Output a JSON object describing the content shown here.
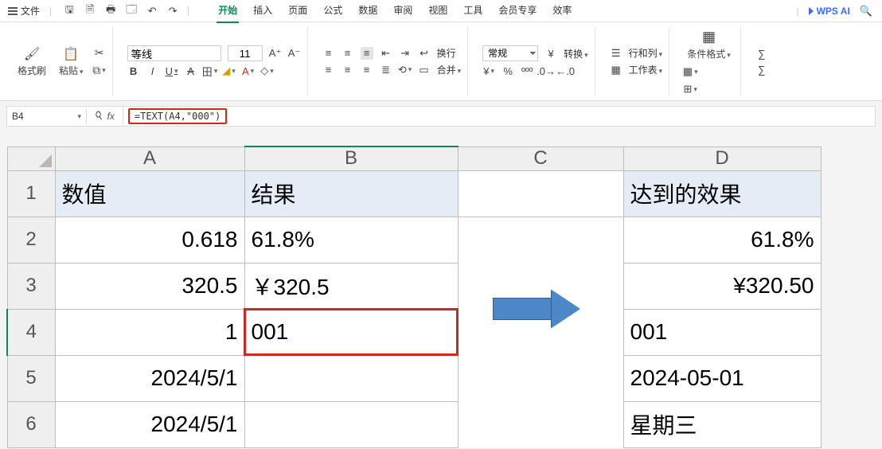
{
  "menu": {
    "file": "文件",
    "tabs": [
      "开始",
      "插入",
      "页面",
      "公式",
      "数据",
      "审阅",
      "视图",
      "工具",
      "会员专享",
      "效率"
    ],
    "active_tab": 0,
    "ai": "WPS AI"
  },
  "ribbon": {
    "format_brush": "格式刷",
    "paste": "粘贴",
    "font_name": "等线",
    "font_size": "11",
    "wrap": "换行",
    "merge": "合并",
    "number_format": "常规",
    "convert": "转换",
    "rowcol": "行和列",
    "worksheet": "工作表",
    "cond_format": "条件格式"
  },
  "formula_bar": {
    "name_box": "B4",
    "formula": "=TEXT(A4,\"000\")"
  },
  "columns": [
    "A",
    "B",
    "C",
    "D"
  ],
  "headers": {
    "A": "数值",
    "B": "结果",
    "D": "达到的效果"
  },
  "rows": [
    {
      "r": "2",
      "A": "0.618",
      "B": "61.8%",
      "D": "61.8%"
    },
    {
      "r": "3",
      "A": "320.5",
      "B": "￥320.5",
      "D": "¥320.50"
    },
    {
      "r": "4",
      "A": "1",
      "B": "001",
      "D": "001"
    },
    {
      "r": "5",
      "A": "2024/5/1",
      "B": "",
      "D": "2024-05-01"
    },
    {
      "r": "6",
      "A": "2024/5/1",
      "B": "",
      "D": "星期三"
    }
  ]
}
